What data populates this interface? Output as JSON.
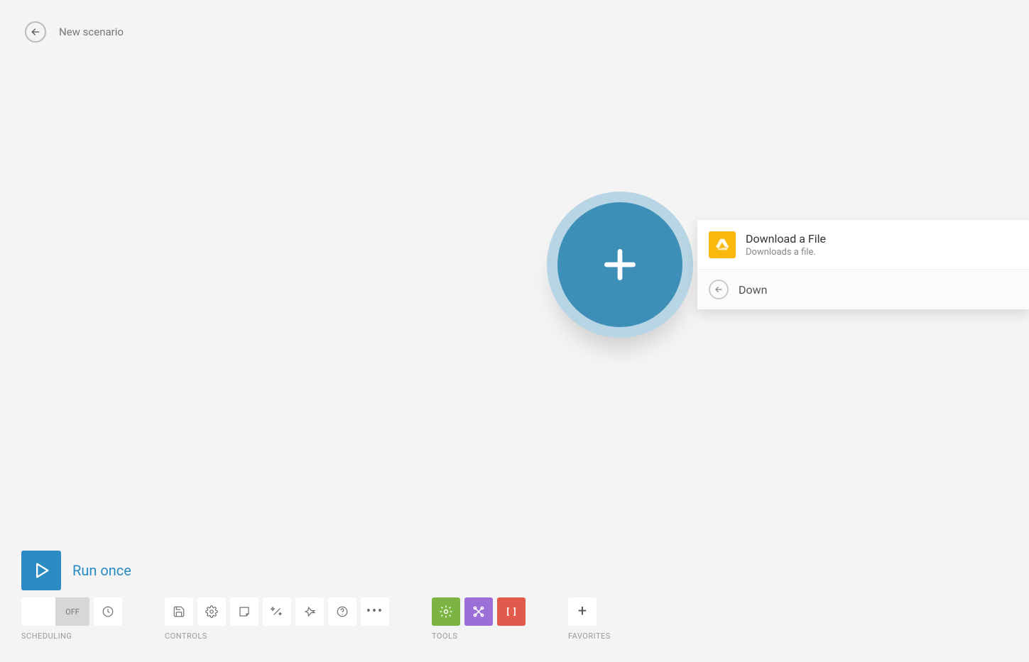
{
  "header": {
    "title": "New scenario"
  },
  "dropdown": {
    "item_title": "Download a File",
    "item_subtitle": "Downloads a file.",
    "search_text": "Down"
  },
  "run": {
    "label": "Run once"
  },
  "scheduling": {
    "label": "SCHEDULING",
    "toggle_state": "OFF"
  },
  "controls": {
    "label": "CONTROLS"
  },
  "tools": {
    "label": "TOOLS"
  },
  "favorites": {
    "label": "FAVORITES"
  }
}
